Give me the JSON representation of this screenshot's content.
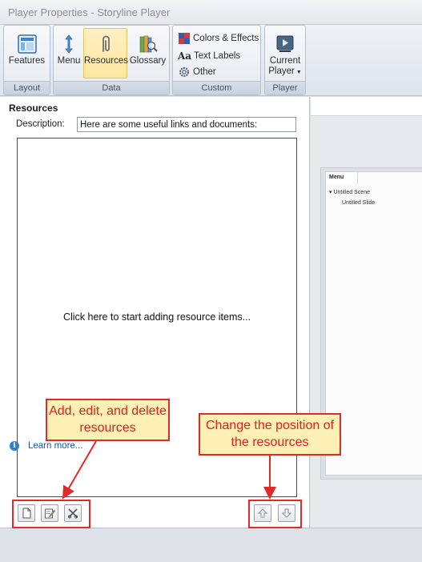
{
  "window": {
    "title": "Player Properties - Storyline Player"
  },
  "ribbon": {
    "groups": {
      "layout": {
        "label": "Layout",
        "features": "Features"
      },
      "data": {
        "label": "Data",
        "menu": "Menu",
        "resources": "Resources",
        "glossary": "Glossary"
      },
      "custom": {
        "label": "Custom",
        "colors": "Colors & Effects",
        "text_labels": "Text Labels",
        "other": "Other"
      },
      "player": {
        "label": "Player",
        "current_line1": "Current",
        "current_line2": "Player"
      }
    }
  },
  "resources": {
    "title": "Resources",
    "description_label": "Description:",
    "description_value": "Here are some useful links and documents:",
    "empty_hint": "Click here to start adding resource items...",
    "learn_more": "Learn more..."
  },
  "preview": {
    "menu_tab": "Menu",
    "scene": "Untitled Scene",
    "slide": "Untitled Slide"
  },
  "annotations": {
    "add_edit_delete": "Add, edit, and delete resources",
    "change_position": "Change the position of the resources"
  },
  "colors": {
    "callout_border": "#e12a2a",
    "callout_fill": "#fdf0b5",
    "active_button": "#fde6a0",
    "link": "#1b57b3"
  }
}
